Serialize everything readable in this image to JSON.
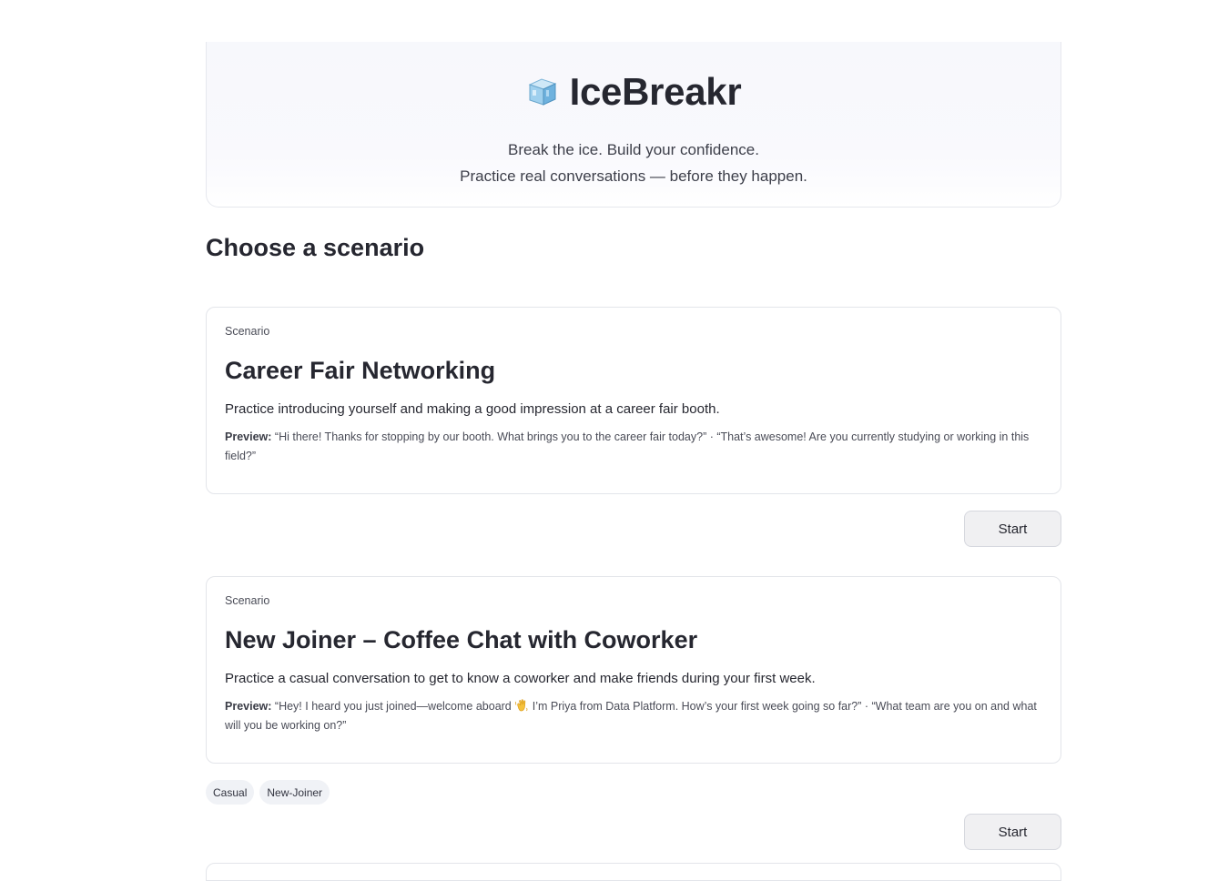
{
  "hero": {
    "icon": "ice-cube-icon",
    "title": "IceBreakr",
    "subtitle_line1": "Break the ice. Build your confidence.",
    "subtitle_line2": "Practice real conversations — before they happen."
  },
  "section_title": "Choose a scenario",
  "scenarios": [
    {
      "kicker": "Scenario",
      "title": "Career Fair Networking",
      "description": "Practice introducing yourself and making a good impression at a career fair booth.",
      "preview_label": "Preview:",
      "preview_text": "“Hi there! Thanks for stopping by our booth. What brings you to the career fair today?” · “That’s awesome! Are you currently studying or working in this field?”",
      "tags": [],
      "start_label": "Start"
    },
    {
      "kicker": "Scenario",
      "title": "New Joiner – Coffee Chat with Coworker",
      "description": "Practice a casual conversation to get to know a coworker and make friends during your first week.",
      "preview_label": "Preview:",
      "preview_text_before": "“Hey! I heard you just joined—welcome aboard ",
      "preview_icon": "waving-hand-icon",
      "preview_text_after": " I’m Priya from Data Platform. How’s your first week going so far?” · “What team are you on and what will you be working on?”",
      "tags": [
        "Casual",
        "New-Joiner"
      ],
      "start_label": "Start"
    }
  ]
}
